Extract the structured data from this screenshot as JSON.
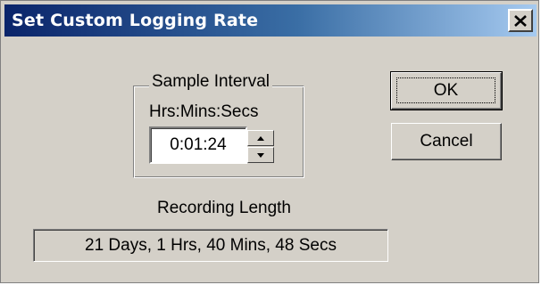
{
  "window": {
    "title": "Set Custom Logging Rate",
    "close_icon": "close-x-icon"
  },
  "sample_interval": {
    "group_label": "Sample Interval",
    "format_label": "Hrs:Mins:Secs",
    "value": "0:01:24",
    "spin_up_icon": "arrow-up-icon",
    "spin_down_icon": "arrow-down-icon"
  },
  "buttons": {
    "ok_label": "OK",
    "cancel_label": "Cancel"
  },
  "recording": {
    "label": "Recording Length",
    "value": "21 Days, 1 Hrs, 40 Mins, 48 Secs"
  },
  "colors": {
    "titlebar_start": "#0a246a",
    "titlebar_end": "#a6caf0",
    "face": "#d4d0c8"
  }
}
